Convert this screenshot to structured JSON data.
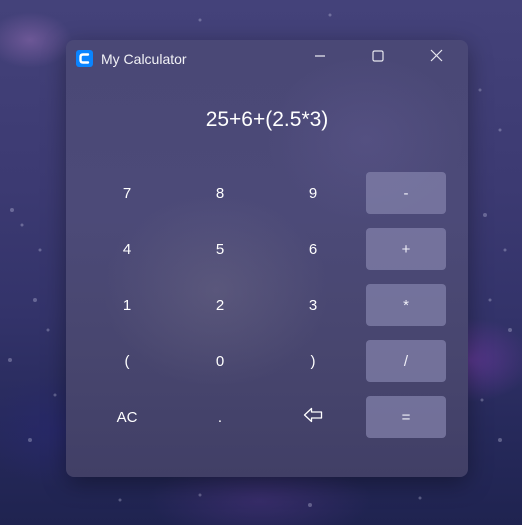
{
  "window": {
    "title": "My Calculator",
    "icon": "calculator-app-icon",
    "accent_color": "#0a84ff"
  },
  "titlebar_buttons": {
    "minimize_icon": "minimize-icon",
    "maximize_icon": "maximize-icon",
    "close_icon": "close-icon"
  },
  "display": {
    "expression": "25+6+(2.5*3)"
  },
  "keypad": {
    "rows": [
      [
        "7",
        "8",
        "9",
        "-"
      ],
      [
        "4",
        "5",
        "6",
        "+"
      ],
      [
        "1",
        "2",
        "3",
        "*"
      ],
      [
        "(",
        "0",
        ")",
        "/"
      ],
      [
        "AC",
        ".",
        "",
        "="
      ]
    ],
    "backspace_icon": "backspace-arrow-icon",
    "operator_button_color": "#7e7ca6"
  }
}
